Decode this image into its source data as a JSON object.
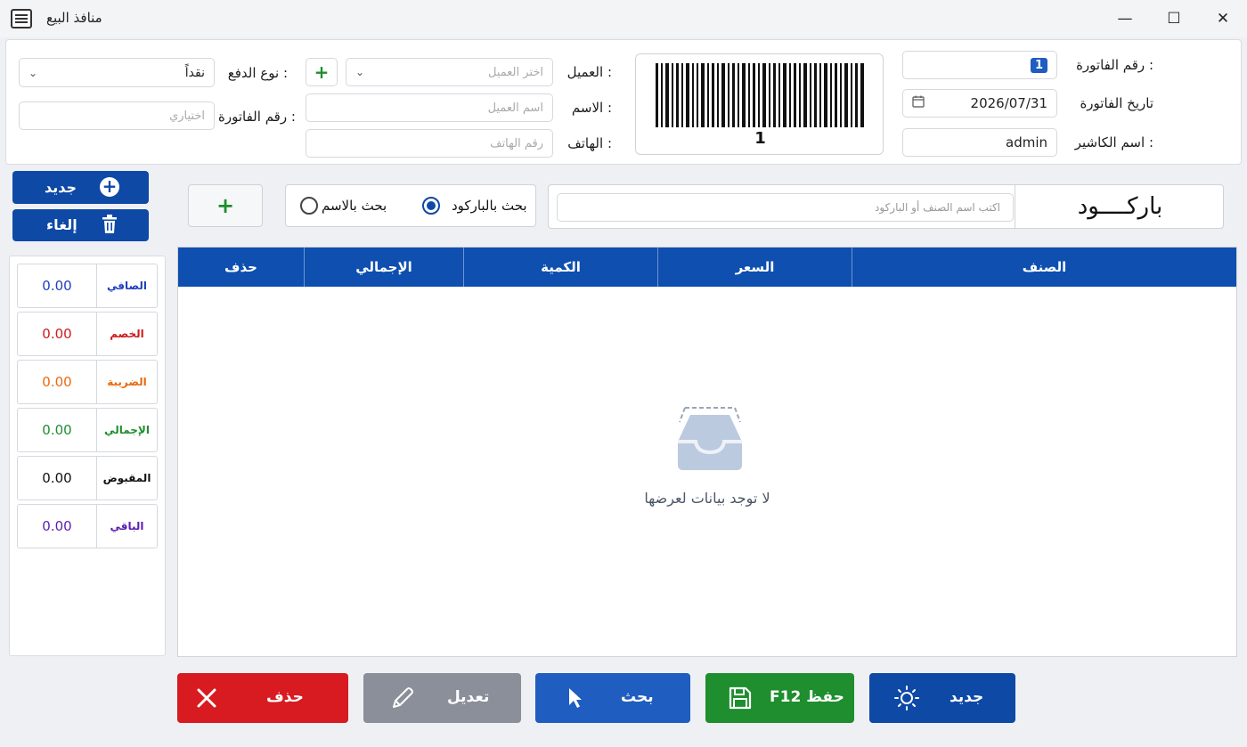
{
  "window": {
    "title": "منافذ البيع",
    "minimize": "—",
    "maximize": "☐",
    "close": "✕"
  },
  "invoice": {
    "number_label": "رقم الفاتورة :",
    "number_value": "1",
    "date_label": "تاريخ الفاتورة",
    "date_value": "2026/07/31",
    "cashier_label": "اسم الكاشير :",
    "cashier_value": "admin",
    "barcode_number": "1"
  },
  "customer": {
    "customer_label": "العميل :",
    "customer_placeholder": "اختر العميل",
    "name_label": "الاسم :",
    "name_placeholder": "اسم العميل",
    "phone_label": "الهاتف :",
    "phone_placeholder": "رقم الهاتف"
  },
  "payment": {
    "type_label": "نوع الدفع :",
    "type_value": "نقداً",
    "invoice_no_label": "رقم الفاتورة :",
    "invoice_no_placeholder": "اختياري"
  },
  "actions_left": {
    "new_label": "جديد",
    "cancel_label": "إلغاء"
  },
  "totals": [
    {
      "label": "الصافي",
      "value": "0.00",
      "color": "#1f3fbf"
    },
    {
      "label": "الخصم",
      "value": "0.00",
      "color": "#d01a1a"
    },
    {
      "label": "الضريبة",
      "value": "0.00",
      "color": "#e86a10"
    },
    {
      "label": "الإجمالي",
      "value": "0.00",
      "color": "#1e8e2e"
    },
    {
      "label": "المقبوض",
      "value": "0.00",
      "color": "#111111"
    },
    {
      "label": "الباقي",
      "value": "0.00",
      "color": "#5a1fb0"
    }
  ],
  "search": {
    "barcode_title": "باركــــود",
    "placeholder": "اكتب اسم الصنف أو الباركود",
    "by_barcode": "بحث بالباركود",
    "by_name": "بحث بالاسم",
    "selected": "barcode"
  },
  "table": {
    "columns": [
      "الصنف",
      "السعر",
      "الكمية",
      "الإجمالي",
      "حذف"
    ],
    "empty_message": "لا توجد بيانات لعرضها"
  },
  "bottom_buttons": {
    "new": "جديد",
    "save": "F12 حفظ",
    "search": "بحث",
    "edit": "تعديل",
    "delete": "حذف"
  },
  "colors": {
    "primary": "#0e49a6",
    "green": "#1e8e2e",
    "red": "#d81b20",
    "gray": "#8a8f9a",
    "blue_button": "#1f5dc0"
  }
}
